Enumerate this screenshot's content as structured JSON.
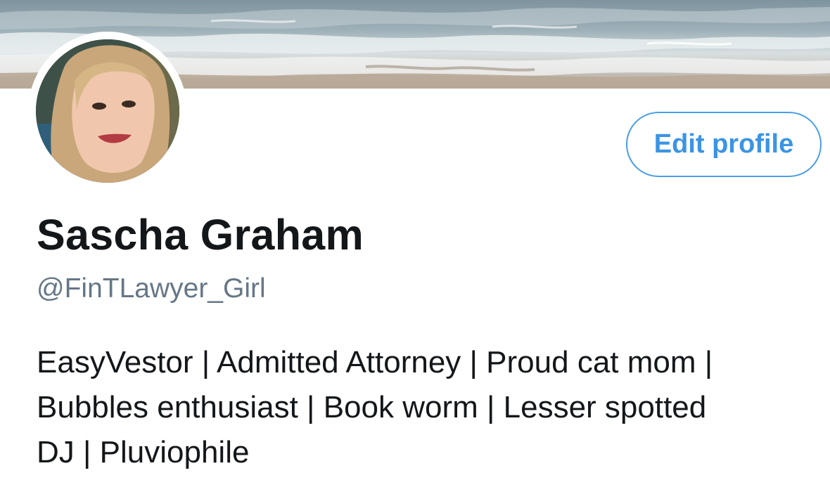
{
  "profile": {
    "display_name": "Sascha Graham",
    "handle": "@FinTLawyer_Girl",
    "bio_lines": [
      "EasyVestor | Admitted Attorney | Proud cat mom |",
      "Bubbles enthusiast | Book worm | Lesser spotted",
      "DJ | Pluviophile"
    ]
  },
  "actions": {
    "edit_profile_label": "Edit profile"
  },
  "images": {
    "banner": "ocean-waves-beach-photo",
    "avatar": "profile-photo-woman-blonde-hair"
  },
  "colors": {
    "accent": "#4a9ee6",
    "name_text": "#14171a",
    "handle_text": "#657786"
  }
}
